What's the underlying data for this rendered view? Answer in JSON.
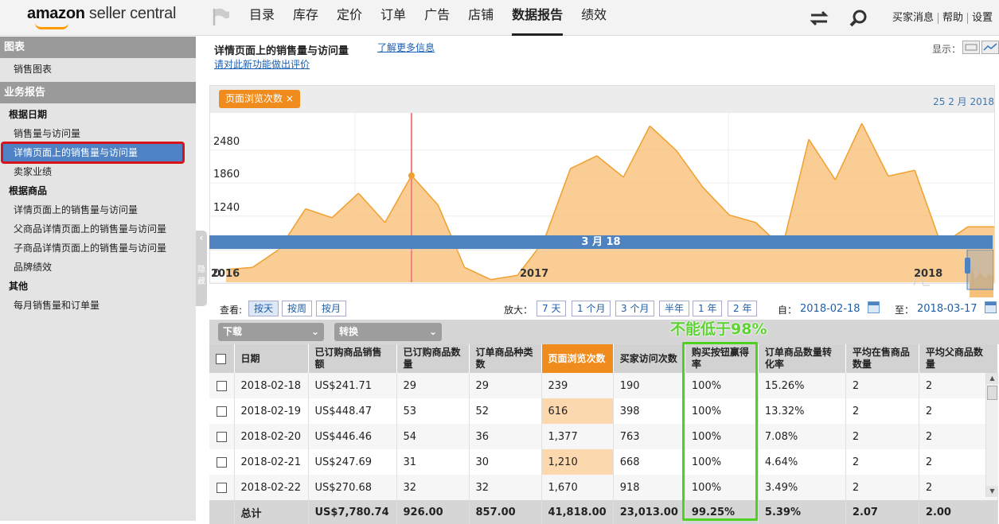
{
  "header": {
    "logo_bold": "amazon",
    "logo_rest": " seller central",
    "nav": [
      "目录",
      "库存",
      "定价",
      "订单",
      "广告",
      "店铺",
      "数据报告",
      "绩效"
    ],
    "active_nav": 6,
    "links": [
      "买家消息",
      "帮助",
      "设置"
    ]
  },
  "sidebar": {
    "sections": [
      {
        "title": "图表",
        "groups": [
          {
            "title": "",
            "items": [
              "销售图表"
            ]
          }
        ]
      },
      {
        "title": "业务报告",
        "groups": [
          {
            "title": "根据日期",
            "items": [
              "销售量与访问量",
              "详情页面上的销售量与访问量",
              "卖家业绩"
            ]
          },
          {
            "title": "根据商品",
            "items": [
              "详情页面上的销售量与访问量",
              "父商品详情页面上的销售量与访问量",
              "子商品详情页面上的销售量与访问量",
              "品牌绩效"
            ]
          },
          {
            "title": "其他",
            "items": [
              "每月销售量和订单量"
            ]
          }
        ]
      }
    ],
    "selected_item": "详情页面上的销售量与访问量",
    "collapse_label": "隐藏"
  },
  "page": {
    "title": "详情页面上的销售量与访问量",
    "learn_more": "了解更多信息",
    "feedback": "请对此新功能做出评价",
    "display_label": "显示："
  },
  "chart_data": {
    "type": "area",
    "series": [
      {
        "name": "页面浏览次数",
        "values": [
          239,
          280,
          616,
          1377,
          1210,
          1670,
          1120,
          2000,
          1450,
          280,
          50,
          130,
          780,
          2130,
          2370,
          1970,
          2930,
          2470,
          1780,
          1260,
          1120,
          650,
          2680,
          1920,
          2980,
          1990,
          2100,
          700,
          1040,
          1040
        ]
      }
    ],
    "x_start": "2018-02-18",
    "yticks": [
      0,
      621,
      1240,
      1860,
      2480
    ],
    "ylim": [
      0,
      3100
    ],
    "marker_index": 7,
    "marker_label": "3 月 18",
    "header_date": "25 2 月 2018",
    "color": "#f7c078",
    "line_color": "#f0a030"
  },
  "timeline": {
    "labels": [
      "2016",
      "2017",
      "2018"
    ]
  },
  "controls": {
    "view_label": "查看:",
    "view_buttons": [
      "按天",
      "按周",
      "按月"
    ],
    "active_view": 0,
    "zoom_label": "放大：",
    "zoom_buttons": [
      "7 天",
      "1 个月",
      "3 个月",
      "半年",
      "1 年",
      "2 年"
    ],
    "from_label": "自：",
    "from_date": "2018-02-18",
    "to_label": "至：",
    "to_date": "2018-03-17",
    "download_label": "下载",
    "convert_label": "转换"
  },
  "annotation": "不能低于98%",
  "table": {
    "headers": [
      "日期",
      "已订购商品销售额",
      "已订购商品数量",
      "订单商品种类数",
      "页面浏览次数",
      "买家访问次数",
      "购买按钮赢得率",
      "订单商品数量转化率",
      "平均在售商品数量",
      "平均父商品数量"
    ],
    "rows": [
      [
        "2018-02-18",
        "US$241.71",
        "29",
        "29",
        "239",
        "190",
        "100%",
        "15.26%",
        "2",
        "2"
      ],
      [
        "2018-02-19",
        "US$448.47",
        "53",
        "52",
        "616",
        "398",
        "100%",
        "13.32%",
        "2",
        "2"
      ],
      [
        "2018-02-20",
        "US$446.46",
        "54",
        "36",
        "1,377",
        "763",
        "100%",
        "7.08%",
        "2",
        "2"
      ],
      [
        "2018-02-21",
        "US$247.69",
        "31",
        "30",
        "1,210",
        "668",
        "100%",
        "4.64%",
        "2",
        "2"
      ],
      [
        "2018-02-22",
        "US$270.68",
        "32",
        "32",
        "1,670",
        "918",
        "100%",
        "3.49%",
        "2",
        "2"
      ]
    ],
    "totals": [
      "总计",
      "US$7,780.74",
      "926.00",
      "857.00",
      "41,818.00",
      "23,013.00",
      "99.25%",
      "5.39%",
      "2.07",
      "2.00"
    ]
  }
}
